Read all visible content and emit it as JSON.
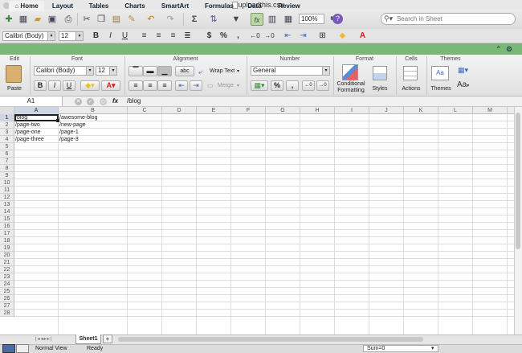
{
  "window": {
    "title": "uploadthis.csv"
  },
  "toolbar": {
    "zoom": "100%",
    "search_placeholder": "Search in Sheet"
  },
  "format": {
    "font": "Calibri (Body)",
    "size": "12",
    "bold": "B",
    "italic": "I",
    "underline": "U",
    "currency": "$",
    "percent": "%"
  },
  "ribbon": {
    "tabs": [
      "Home",
      "Layout",
      "Tables",
      "Charts",
      "SmartArt",
      "Formulas",
      "Data",
      "Review"
    ],
    "groups": [
      "Edit",
      "Font",
      "Alignment",
      "Number",
      "Format",
      "Cells",
      "Themes"
    ],
    "paste": "Paste",
    "font": "Calibri (Body)",
    "size": "12",
    "wrap_text": "Wrap Text",
    "merge": "Merge",
    "number_format": "General",
    "conditional_formatting": "Conditional Formatting",
    "styles": "Styles",
    "actions": "Actions",
    "themes": "Themes",
    "abc": "abc",
    "aa": "Aa"
  },
  "formula_bar": {
    "name_box": "A1",
    "fx": "fx",
    "content": "/blog"
  },
  "sheet": {
    "columns": [
      "A",
      "B",
      "C",
      "D",
      "E",
      "F",
      "G",
      "H",
      "I",
      "J",
      "K",
      "L",
      "M"
    ],
    "row_count": 28,
    "rows": [
      [
        "/blog",
        "/awesome-blog"
      ],
      [
        "/page-two",
        "/new-page"
      ],
      [
        "/page-one",
        "/page-1"
      ],
      [
        "/page-three",
        "/page-3"
      ]
    ],
    "tab": "Sheet1",
    "add_tab": "+"
  },
  "status": {
    "view": "Normal View",
    "state": "Ready",
    "sum": "Sum=0"
  }
}
